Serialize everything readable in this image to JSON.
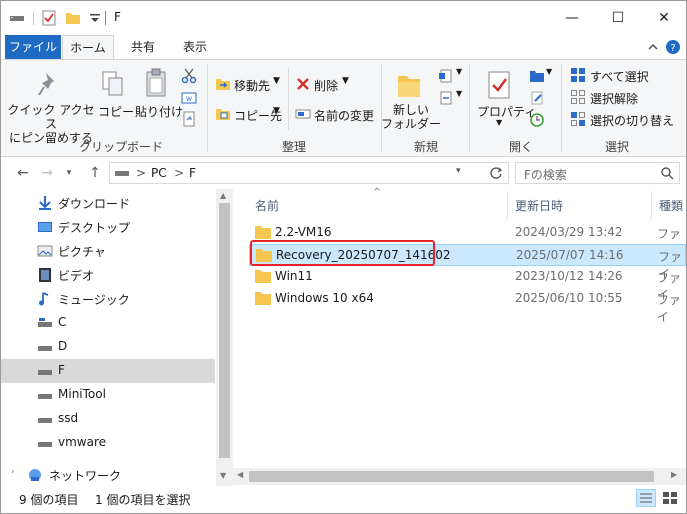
{
  "window": {
    "title": "F",
    "controls": {
      "minimize": "—",
      "maximize": "☐",
      "close": "✕"
    }
  },
  "tabs": [
    {
      "label": "ファイル"
    },
    {
      "label": "ホーム"
    },
    {
      "label": "共有"
    },
    {
      "label": "表示"
    }
  ],
  "ribbon": {
    "clipboard": {
      "pin_label_line1": "クイック アクセス",
      "pin_label_line2": "にピン留めする",
      "copy_label": "コピー",
      "paste_label": "貼り付け",
      "group_label": "クリップボード"
    },
    "organize": {
      "move_to": "移動先",
      "copy_to": "コピー先",
      "delete": "削除",
      "rename": "名前の変更",
      "group_label": "整理"
    },
    "new": {
      "new_folder_line1": "新しい",
      "new_folder_line2": "フォルダー",
      "group_label": "新規"
    },
    "open": {
      "properties": "プロパティ",
      "group_label": "開く"
    },
    "select": {
      "select_all": "すべて選択",
      "select_none": "選択解除",
      "invert": "選択の切り替え",
      "group_label": "選択"
    }
  },
  "address": {
    "path": [
      "PC",
      "F"
    ],
    "sep": ">",
    "search_placeholder": "Fの検索"
  },
  "nav_items": [
    {
      "label": "ダウンロード",
      "icon": "download-icon"
    },
    {
      "label": "デスクトップ",
      "icon": "desktop-icon"
    },
    {
      "label": "ピクチャ",
      "icon": "pictures-icon"
    },
    {
      "label": "ビデオ",
      "icon": "video-icon"
    },
    {
      "label": "ミュージック",
      "icon": "music-icon"
    },
    {
      "label": "C",
      "icon": "drive-icon"
    },
    {
      "label": "D",
      "icon": "drive-icon"
    },
    {
      "label": "F",
      "icon": "drive-icon"
    },
    {
      "label": "MiniTool",
      "icon": "drive-icon"
    },
    {
      "label": "ssd",
      "icon": "drive-icon"
    },
    {
      "label": "vmware",
      "icon": "drive-icon"
    },
    {
      "label": "ネットワーク",
      "icon": "network-icon"
    }
  ],
  "columns": {
    "name": "名前",
    "date": "更新日時",
    "type": "種類"
  },
  "files": [
    {
      "name": "2.2-VM16",
      "date": "2024/03/29 13:42",
      "type": "ファイ"
    },
    {
      "name": "Recovery_20250707_141602",
      "date": "2025/07/07 14:16",
      "type": "ファイ"
    },
    {
      "name": "Win11",
      "date": "2023/10/12 14:26",
      "type": "ファイ"
    },
    {
      "name": "Windows 10 x64",
      "date": "2025/06/10 10:55",
      "type": "ファイ"
    }
  ],
  "status": {
    "item_count": "9 個の項目",
    "selected_count": "1 個の項目を選択"
  },
  "colors": {
    "accent": "#1f6bc4",
    "selection": "#cce8ff",
    "highlight_box": "#e8242a",
    "folder": "#f5c650"
  }
}
